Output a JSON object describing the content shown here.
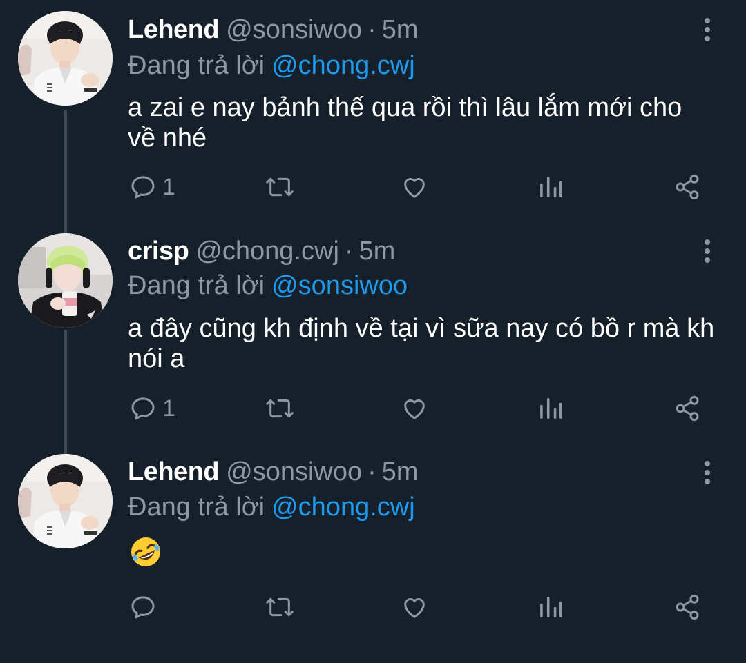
{
  "colors": {
    "background": "#15202b",
    "text": "#ffffff",
    "muted": "#8b98a5",
    "link": "#1d9bf0",
    "thread_line": "#3d4b57"
  },
  "tweets": [
    {
      "display_name": "Lehend",
      "handle": "@sonsiwoo",
      "separator": "·",
      "time": "5m",
      "reply_label": "Đang trả lời",
      "reply_to": "@chong.cwj",
      "text": "a zai e nay bảnh thế qua rồi thì lâu lắm mới cho về nhé",
      "reply_count": "1",
      "icons": [
        "more-vertical-icon",
        "reply-icon",
        "retweet-icon",
        "like-icon",
        "analytics-icon",
        "share-icon"
      ]
    },
    {
      "display_name": "crisp",
      "handle": "@chong.cwj",
      "separator": "·",
      "time": "5m",
      "reply_label": "Đang trả lời",
      "reply_to": "@sonsiwoo",
      "text": "a đây cũng kh định về tại vì sữa nay có bồ r mà kh nói a",
      "reply_count": "1",
      "icons": [
        "more-vertical-icon",
        "reply-icon",
        "retweet-icon",
        "like-icon",
        "analytics-icon",
        "share-icon"
      ]
    },
    {
      "display_name": "Lehend",
      "handle": "@sonsiwoo",
      "separator": "·",
      "time": "5m",
      "reply_label": "Đang trả lời",
      "reply_to": "@chong.cwj",
      "emoji": "rolling-on-floor-laughing-emoji",
      "reply_count": "",
      "icons": [
        "more-vertical-icon",
        "reply-icon",
        "retweet-icon",
        "like-icon",
        "analytics-icon",
        "share-icon"
      ]
    }
  ]
}
